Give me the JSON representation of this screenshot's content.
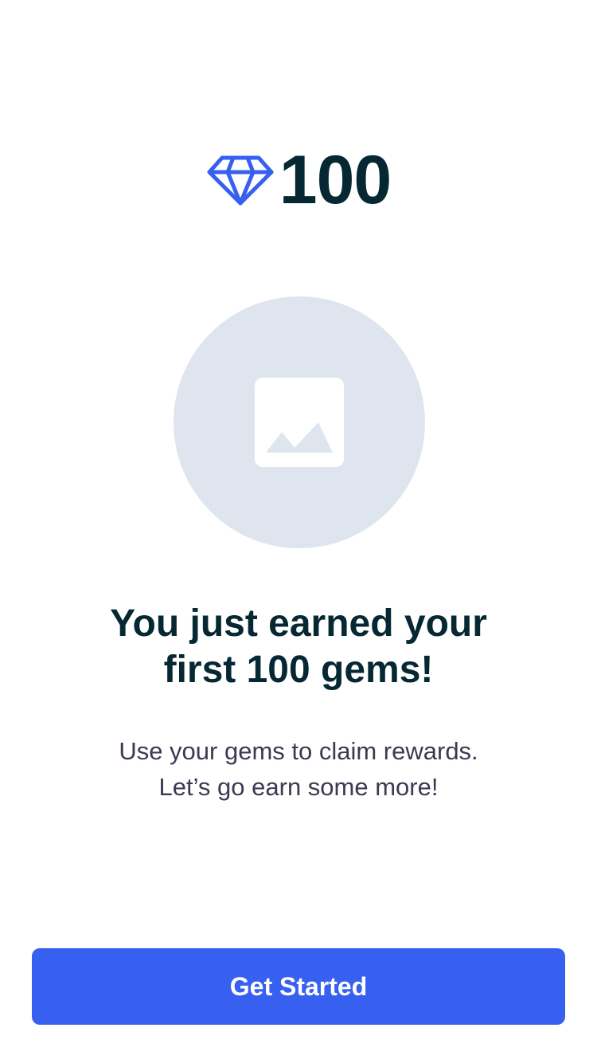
{
  "reward": {
    "gem_icon": "gem-icon",
    "gem_count": "100"
  },
  "hero": {
    "icon": "image-placeholder-icon"
  },
  "headline": {
    "line1": "You just earned your",
    "line2": "first 100 gems!"
  },
  "subtitle": {
    "line1": "Use your gems to claim rewards.",
    "line2": "Let’s go earn some more!"
  },
  "cta": {
    "label": "Get Started"
  },
  "colors": {
    "accent": "#375ff0",
    "heading": "#062832",
    "body_text": "#3c3a52",
    "placeholder_bg": "#dfe5ee",
    "background": "#ffffff"
  }
}
